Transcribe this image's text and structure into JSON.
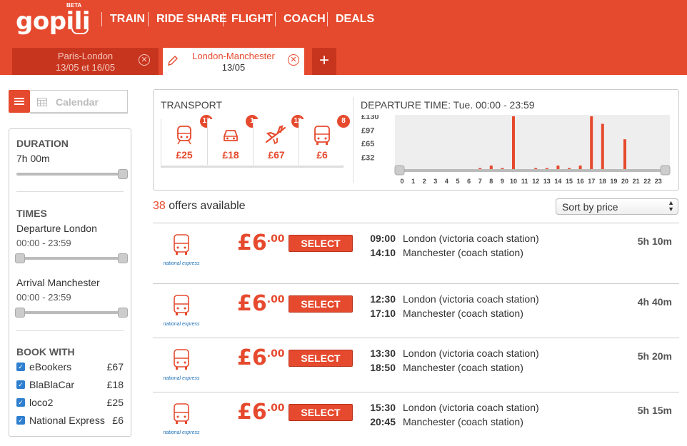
{
  "brand": {
    "name": "gopili",
    "beta": "BETA"
  },
  "nav": [
    "TRAIN",
    "RIDE SHARE",
    "FLIGHT",
    "COACH",
    "DEALS"
  ],
  "tabs": [
    {
      "title": "Paris-London",
      "dates": "13/05 et 16/05"
    },
    {
      "title": "London-Manchester",
      "dates": "13/05"
    }
  ],
  "add_tab": "+",
  "calendar_label": "Calendar",
  "filters": {
    "duration_title": "DURATION",
    "duration_value": "7h 00m",
    "times_title": "TIMES",
    "departure_label": "Departure London",
    "departure_range": "00:00 - 23:59",
    "arrival_label": "Arrival Manchester",
    "arrival_range": "00:00 - 23:59",
    "bookwith_title": "BOOK WITH",
    "bookwith": [
      {
        "name": "eBookers",
        "price": "£67"
      },
      {
        "name": "BlaBlaCar",
        "price": "£18"
      },
      {
        "name": "loco2",
        "price": "£25"
      },
      {
        "name": "National Express",
        "price": "£6"
      }
    ]
  },
  "transport": {
    "title": "TRANSPORT",
    "modes": [
      {
        "icon": "train-icon",
        "count": "17",
        "price": "£25"
      },
      {
        "icon": "car-icon",
        "count": "1",
        "price": "£18"
      },
      {
        "icon": "plane-icon",
        "count": "12",
        "price": "£67"
      },
      {
        "icon": "bus-icon",
        "count": "8",
        "price": "£6"
      }
    ]
  },
  "departure": {
    "title": "DEPARTURE TIME:",
    "range": "Tue. 00:00 - 23:59"
  },
  "chart_data": {
    "type": "bar",
    "categories": [
      "0",
      "1",
      "2",
      "3",
      "4",
      "5",
      "6",
      "7",
      "8",
      "9",
      "10",
      "11",
      "12",
      "13",
      "14",
      "15",
      "16",
      "17",
      "18",
      "19",
      "20",
      "21",
      "22",
      "23"
    ],
    "values": [
      0,
      0,
      0,
      0,
      0,
      0,
      0,
      6,
      12,
      6,
      130,
      0,
      6,
      6,
      12,
      6,
      12,
      130,
      112,
      0,
      75,
      0,
      0,
      0
    ],
    "yticks": [
      "£130",
      "£97",
      "£65",
      "£32"
    ],
    "ylim": [
      0,
      130
    ],
    "color": "#e64a2e"
  },
  "offers_count": "38",
  "offers_label": "offers available",
  "sort": {
    "selected": "Sort by price"
  },
  "operator": "national express",
  "select_label": "SELECT",
  "offers": [
    {
      "price": "£6",
      "pence": ".00",
      "dep_time": "09:00",
      "dep_station": "London (victoria coach station)",
      "arr_time": "14:10",
      "arr_station": "Manchester (coach station)",
      "duration": "5h 10m"
    },
    {
      "price": "£6",
      "pence": ".00",
      "dep_time": "12:30",
      "dep_station": "London (victoria coach station)",
      "arr_time": "17:10",
      "arr_station": "Manchester (coach station)",
      "duration": "4h 40m"
    },
    {
      "price": "£6",
      "pence": ".00",
      "dep_time": "13:30",
      "dep_station": "London (victoria coach station)",
      "arr_time": "18:50",
      "arr_station": "Manchester (coach station)",
      "duration": "5h 20m"
    },
    {
      "price": "£6",
      "pence": ".00",
      "dep_time": "15:30",
      "dep_station": "London (victoria coach station)",
      "arr_time": "20:45",
      "arr_station": "Manchester (coach station)",
      "duration": "5h 15m"
    }
  ]
}
